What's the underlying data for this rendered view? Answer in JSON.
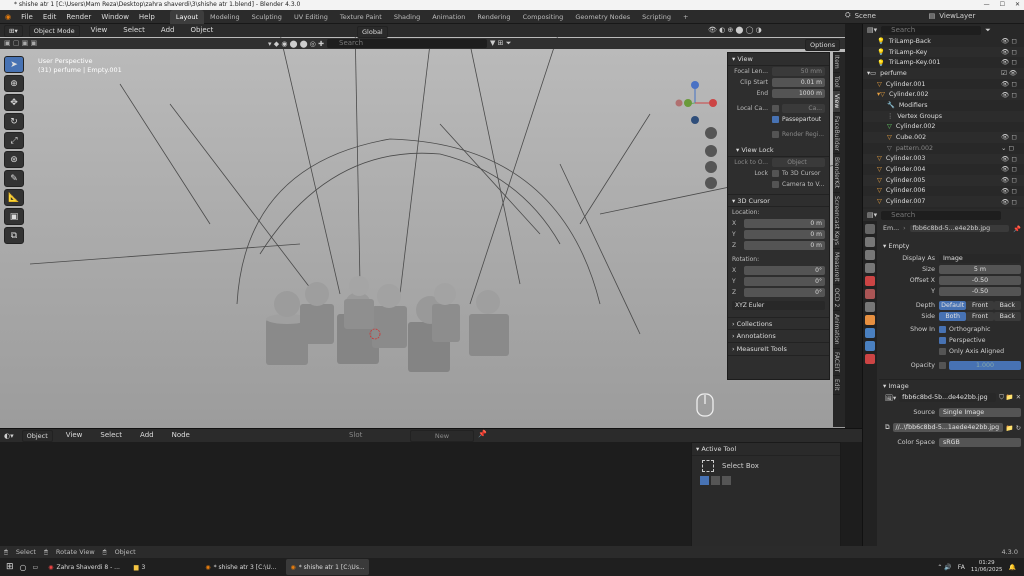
{
  "titlebar": {
    "text": "* shishe atr 1 [C:\\Users\\Mam Reza\\Desktop\\zahra shaverdi\\3\\shishe atr 1.blend] - Blender 4.3.0"
  },
  "menu": [
    "File",
    "Edit",
    "Render",
    "Window",
    "Help"
  ],
  "workspaces": [
    "Layout",
    "Modeling",
    "Sculpting",
    "UV Editing",
    "Texture Paint",
    "Shading",
    "Animation",
    "Rendering",
    "Compositing",
    "Geometry Nodes",
    "Scripting"
  ],
  "scene": {
    "label": "Scene",
    "viewlayer": "ViewLayer"
  },
  "viewport": {
    "mode": "Object Mode",
    "menus": [
      "View",
      "Select",
      "Add",
      "Object"
    ],
    "orientation": "Global",
    "options": "Options",
    "overlay_title": "User Perspective",
    "overlay_sub": "(31) perfume | Empty.001",
    "search_placeholder": "Search"
  },
  "npanel": {
    "view": {
      "title": "View",
      "focal_label": "Focal Len...",
      "focal_value": "50 mm",
      "clip_start_label": "Clip Start",
      "clip_start_value": "0.01 m",
      "end_label": "End",
      "end_value": "1000 m",
      "local_camera_label": "Local Ca...",
      "local_camera_value": "Ca...",
      "passepartout": "Passepartout",
      "render_region": "Render Regi..."
    },
    "view_lock": {
      "title": "View Lock",
      "lock_to_label": "Lock to O...",
      "lock_to_value": "Object",
      "lock_label": "Lock",
      "to_cursor": "To 3D Cursor",
      "camera_to_view": "Camera to V..."
    },
    "cursor": {
      "title": "3D Cursor",
      "location": "Location:",
      "x": "X",
      "y": "Y",
      "z": "Z",
      "loc_x": "0 m",
      "loc_y": "0 m",
      "loc_z": "0 m",
      "rotation": "Rotation:",
      "rot_x": "0°",
      "rot_y": "0°",
      "rot_z": "0°",
      "euler": "XYZ Euler"
    },
    "collapsed": [
      "Collections",
      "Annotations",
      "MeasureIt Tools"
    ]
  },
  "ntabs": [
    "Item",
    "Tool",
    "View",
    "FaceBuilder",
    "BlenderKit",
    "Screencast Keys",
    "MeasureIt",
    "OCD 2",
    "Animation",
    "FACEIT",
    "Edit"
  ],
  "node_editor": {
    "object_label": "Object",
    "menus": [
      "View",
      "Select",
      "Add",
      "Node"
    ],
    "slot_label": "Slot",
    "new_label": "New"
  },
  "active_tool": {
    "title": "Active Tool",
    "tool": "Select Box"
  },
  "outliner": {
    "search_placeholder": "Search",
    "rows": [
      "TriLamp-Back",
      "TriLamp-Key",
      "TriLamp-Key.001",
      "perfume",
      "Cylinder.001",
      "Cylinder.002",
      "Modifiers",
      "Vertex Groups",
      "Cylinder.002",
      "Cube.002",
      "pattern.002",
      "Cylinder.003",
      "Cylinder.004",
      "Cylinder.005",
      "Cylinder.006",
      "Cylinder.007"
    ]
  },
  "properties": {
    "search_placeholder": "Search",
    "object_name": "Em...",
    "image_name": "fbb6c8bd-5...e4e2bb.jpg",
    "empty_title": "Empty",
    "display_as_label": "Display As",
    "display_as_value": "Image",
    "size_label": "Size",
    "size_value": "5 m",
    "offset_x_label": "Offset X",
    "offset_x_value": "-0.50",
    "y_label": "Y",
    "y_value": "-0.50",
    "depth_label": "Depth",
    "depth_opts": [
      "Default",
      "Front",
      "Back"
    ],
    "side_label": "Side",
    "side_opts": [
      "Both",
      "Front",
      "Back"
    ],
    "show_in_label": "Show In",
    "orthographic": "Orthographic",
    "perspective": "Perspective",
    "only_axis": "Only Axis Aligned",
    "opacity_label": "Opacity",
    "opacity_value": "1.000",
    "image_title": "Image",
    "image_file": "fbb6c8bd-5b...de4e2bb.jpg",
    "source_label": "Source",
    "source_value": "Single Image",
    "path_value": "//..\\fbb6c8bd-5...1aede4e2bb.jpg",
    "colorspace_label": "Color Space",
    "colorspace_value": "sRGB"
  },
  "status": {
    "select": "Select",
    "rotate": "Rotate View",
    "object": "Object",
    "version": "4.3.0"
  },
  "taskbar": {
    "items": [
      "Zahra Shaverdi 8 - ...",
      "3",
      "* shishe atr 3 [C:\\U...",
      "* shishe atr 1 [C:\\Us..."
    ],
    "time": "01:29",
    "date": "11/06/2025",
    "lang": "FA"
  }
}
